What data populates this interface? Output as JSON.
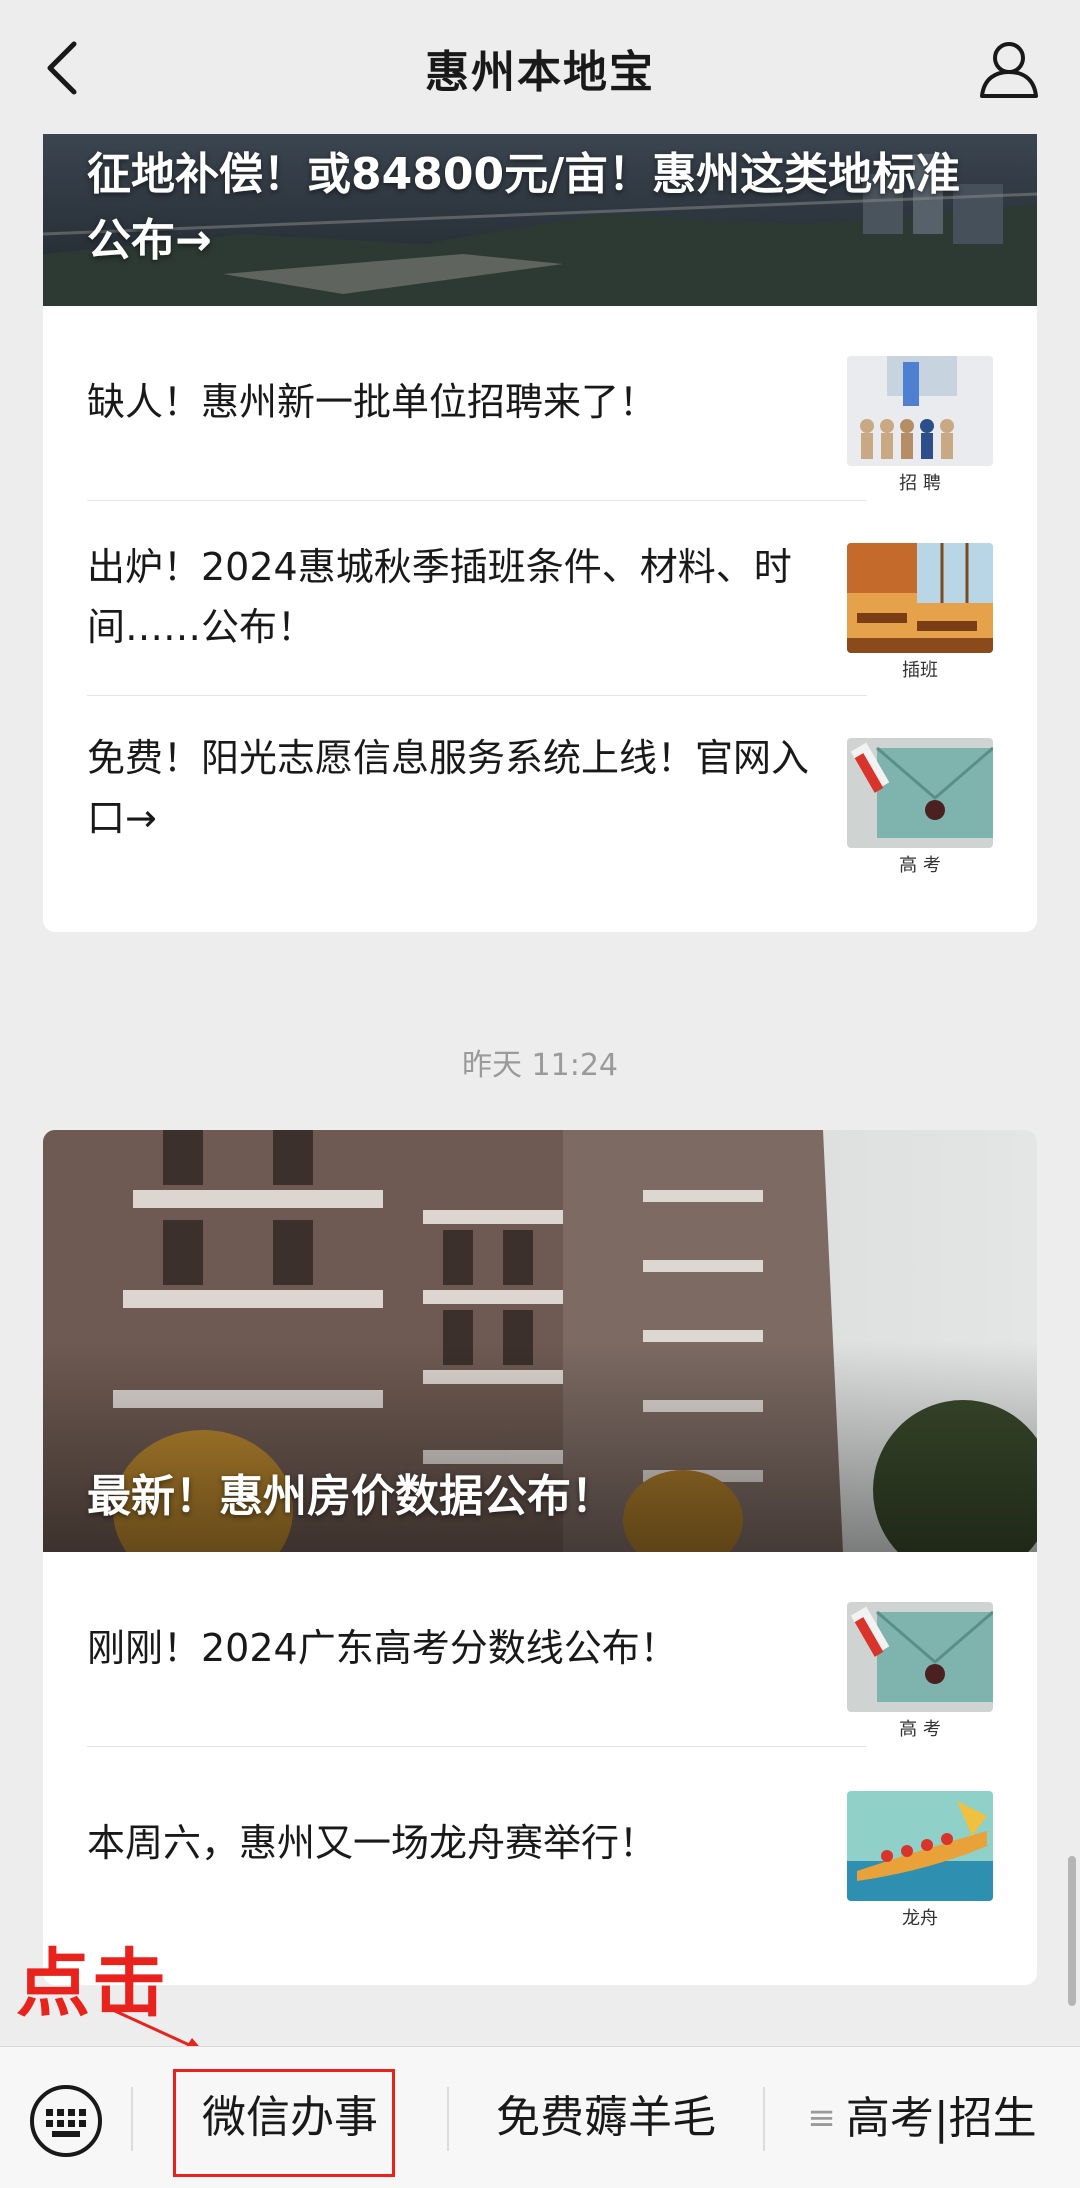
{
  "header": {
    "title": "惠州本地宝"
  },
  "feed": {
    "group1": {
      "hero_title": "征地补偿！或84800元/亩！惠州这类地标准公布→",
      "items": [
        {
          "text": "缺人！惠州新一批单位招聘来了！",
          "thumb_caption": "招 聘"
        },
        {
          "text": "出炉！2024惠城秋季插班条件、材料、时间……公布！",
          "thumb_caption": "插班"
        },
        {
          "text": "免费！阳光志愿信息服务系统上线！官网入口→",
          "thumb_caption": "高 考"
        }
      ]
    },
    "timestamp": "昨天 11:24",
    "group2": {
      "hero_title": "最新！惠州房价数据公布！",
      "items": [
        {
          "text": "刚刚！2024广东高考分数线公布！",
          "thumb_caption": "高 考"
        },
        {
          "text": "本周六，惠州又一场龙舟赛举行！",
          "thumb_caption": "龙舟"
        }
      ]
    }
  },
  "annotation": {
    "text": "点击",
    "color": "#e8231d"
  },
  "bottom_menu": {
    "items": [
      {
        "label": "微信办事"
      },
      {
        "label": "免费薅羊毛"
      },
      {
        "label": "高考|招生",
        "icon": "≡"
      }
    ]
  },
  "icons": [
    "back-arrow-icon",
    "profile-icon",
    "keyboard-icon",
    "menu-lines-icon"
  ]
}
